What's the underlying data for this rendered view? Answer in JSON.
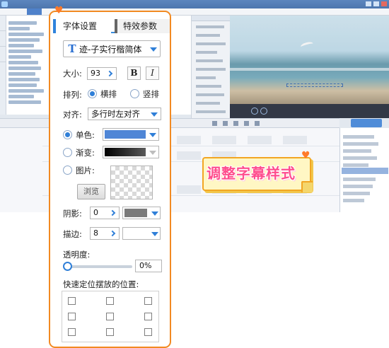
{
  "app": {
    "title": "",
    "menu": [
      "",
      "",
      "",
      "",
      "",
      "",
      "",
      ""
    ]
  },
  "panel": {
    "tabs": [
      "字体设置",
      "特效参数"
    ],
    "font_name": "迹-子实行楷简体",
    "font_icon": "T",
    "size_label": "大小:",
    "size_value": "93",
    "bold_label": "B",
    "italic_label": "I",
    "layout_label": "排列:",
    "layout_options": [
      "横排",
      "竖排"
    ],
    "layout_selected": "横排",
    "align_label": "对齐:",
    "align_value": "多行时左对齐",
    "fill_options": {
      "solid": "单色:",
      "gradient": "渐变:",
      "image": "图片:"
    },
    "fill_selected": "单色",
    "solid_color": "#4f86d6",
    "gradient_colors": [
      "#000000",
      "#5a5a5a"
    ],
    "browse_label": "浏览",
    "shadow_label": "阴影:",
    "shadow_value": "0",
    "shadow_color": "#7b7b7b",
    "stroke_label": "描边:",
    "stroke_value": "8",
    "opacity_label": "透明度:",
    "opacity_value": "0%",
    "opacity_fraction": 0.0,
    "position_label": "快速定位摆放的位置:"
  },
  "highlight": {
    "text": "调整字幕样式"
  },
  "accent_color": "#f28a22",
  "tab_color": "#3a8dde"
}
